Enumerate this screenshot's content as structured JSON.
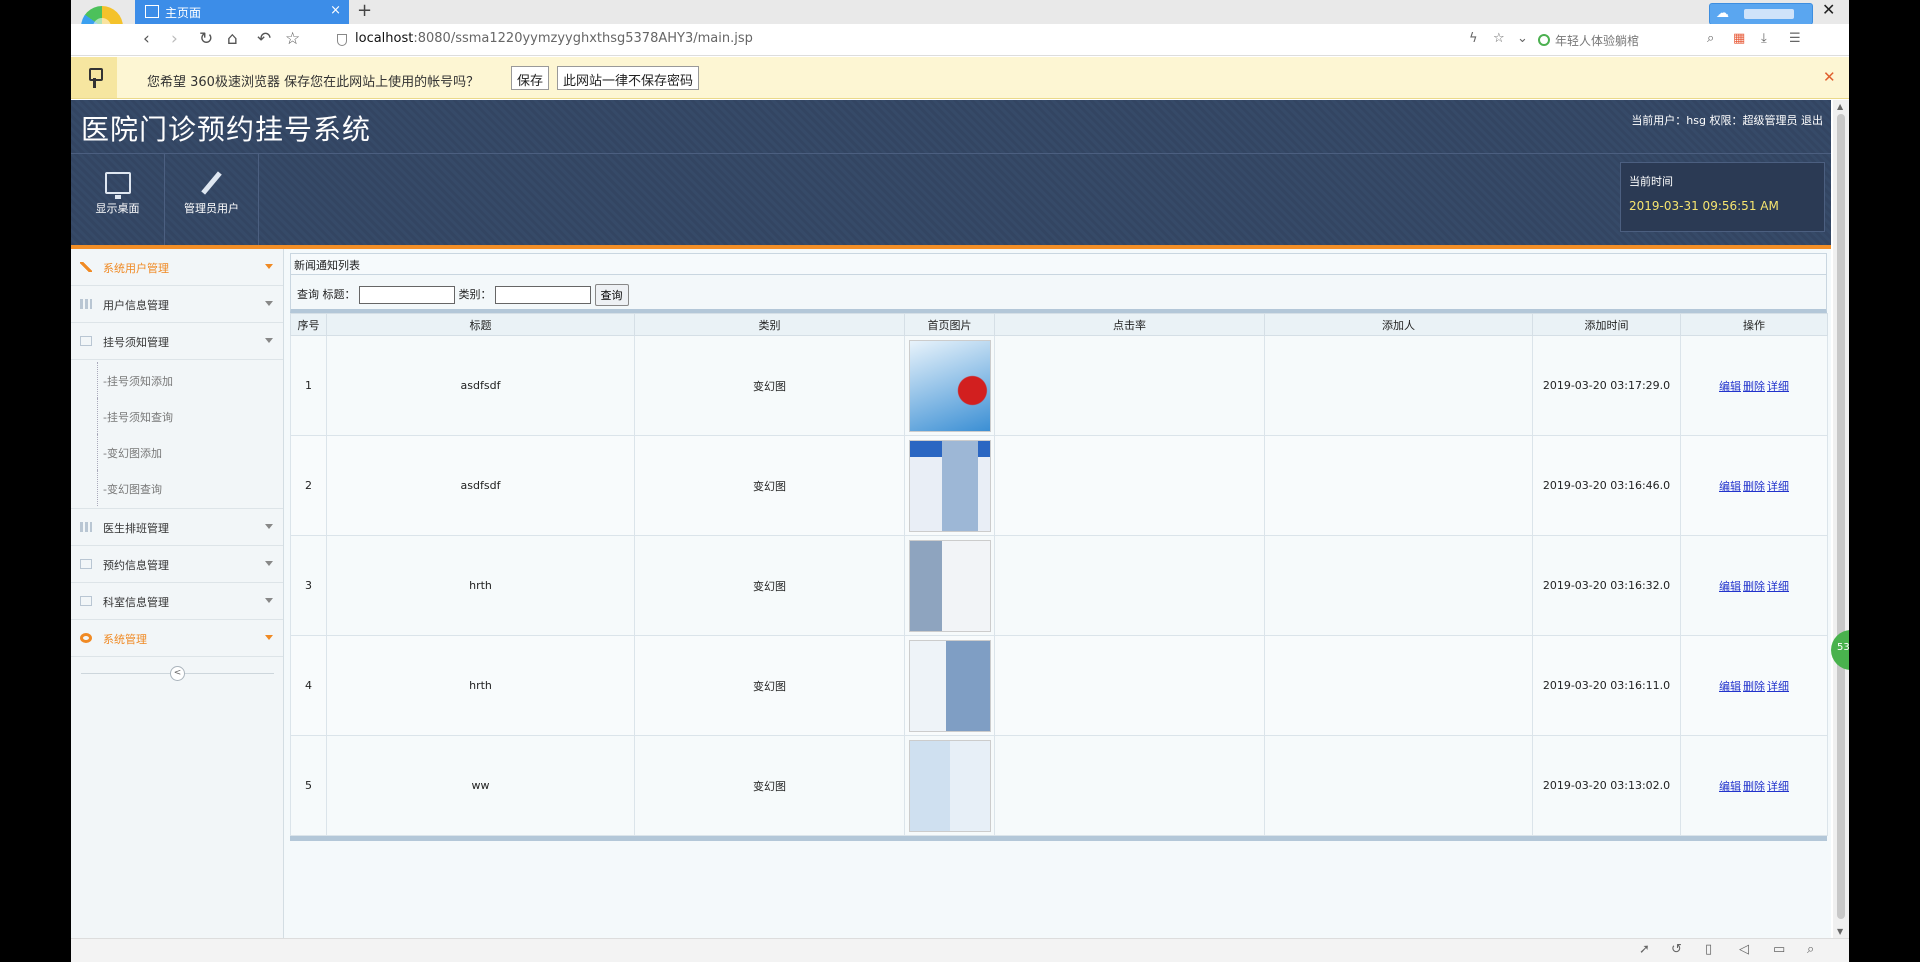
{
  "browser": {
    "tab_title": "主页面",
    "tab_close": "×",
    "new_tab": "+",
    "url_host": "localhost",
    "url_rest": ":8080/ssma1220yymzyyghxthsg5378AHY3/main.jsp",
    "search_hint": "年轻人体验躺棺",
    "window_close": "✕"
  },
  "password_bar": {
    "message": "您希望 360极速浏览器 保存您在此网站上使用的帐号吗？",
    "save_label": "保存",
    "never_label": "此网站一律不保存密码",
    "close": "✕"
  },
  "app": {
    "title": "医院门诊预约挂号系统",
    "user_info": "当前用户：hsg 权限：超级管理员 退出",
    "quick": [
      {
        "label": "显示桌面"
      },
      {
        "label": "管理员用户"
      }
    ],
    "time_label": "当前时间",
    "time_value": "2019-03-31 09:56:51 AM"
  },
  "sidebar": {
    "items": [
      {
        "label": "系统用户管理",
        "active": true
      },
      {
        "label": "用户信息管理"
      },
      {
        "label": "挂号须知管理"
      }
    ],
    "sub_items": [
      {
        "label": "-挂号须知添加"
      },
      {
        "label": "-挂号须知查询"
      },
      {
        "label": "-变幻图添加"
      },
      {
        "label": "-变幻图查询"
      }
    ],
    "items_after": [
      {
        "label": "医生排班管理"
      },
      {
        "label": "预约信息管理"
      },
      {
        "label": "科室信息管理"
      },
      {
        "label": "系统管理",
        "active": true
      }
    ],
    "collapse": "<"
  },
  "main": {
    "panel_title": "新闻通知列表",
    "query": {
      "label": "查询",
      "title_label": "标题：",
      "title_value": "",
      "category_label": "类别：",
      "category_value": "",
      "button": "查询"
    },
    "columns": [
      "序号",
      "标题",
      "类别",
      "首页图片",
      "点击率",
      "添加人",
      "添加时间",
      "操作"
    ],
    "rows": [
      {
        "no": "1",
        "title": "asdfsdf",
        "category": "变幻图",
        "clicks": "",
        "adder": "",
        "time": "2019-03-20 03:17:29.0"
      },
      {
        "no": "2",
        "title": "asdfsdf",
        "category": "变幻图",
        "clicks": "",
        "adder": "",
        "time": "2019-03-20 03:16:46.0"
      },
      {
        "no": "3",
        "title": "hrth",
        "category": "变幻图",
        "clicks": "",
        "adder": "",
        "time": "2019-03-20 03:16:32.0"
      },
      {
        "no": "4",
        "title": "hrth",
        "category": "变幻图",
        "clicks": "",
        "adder": "",
        "time": "2019-03-20 03:16:11.0"
      },
      {
        "no": "5",
        "title": "ww",
        "category": "变幻图",
        "clicks": "",
        "adder": "",
        "time": "2019-03-20 03:13:02.0"
      }
    ],
    "ops": {
      "edit": "编辑",
      "delete": "删除",
      "detail": "详细"
    }
  },
  "float_badge": "53"
}
